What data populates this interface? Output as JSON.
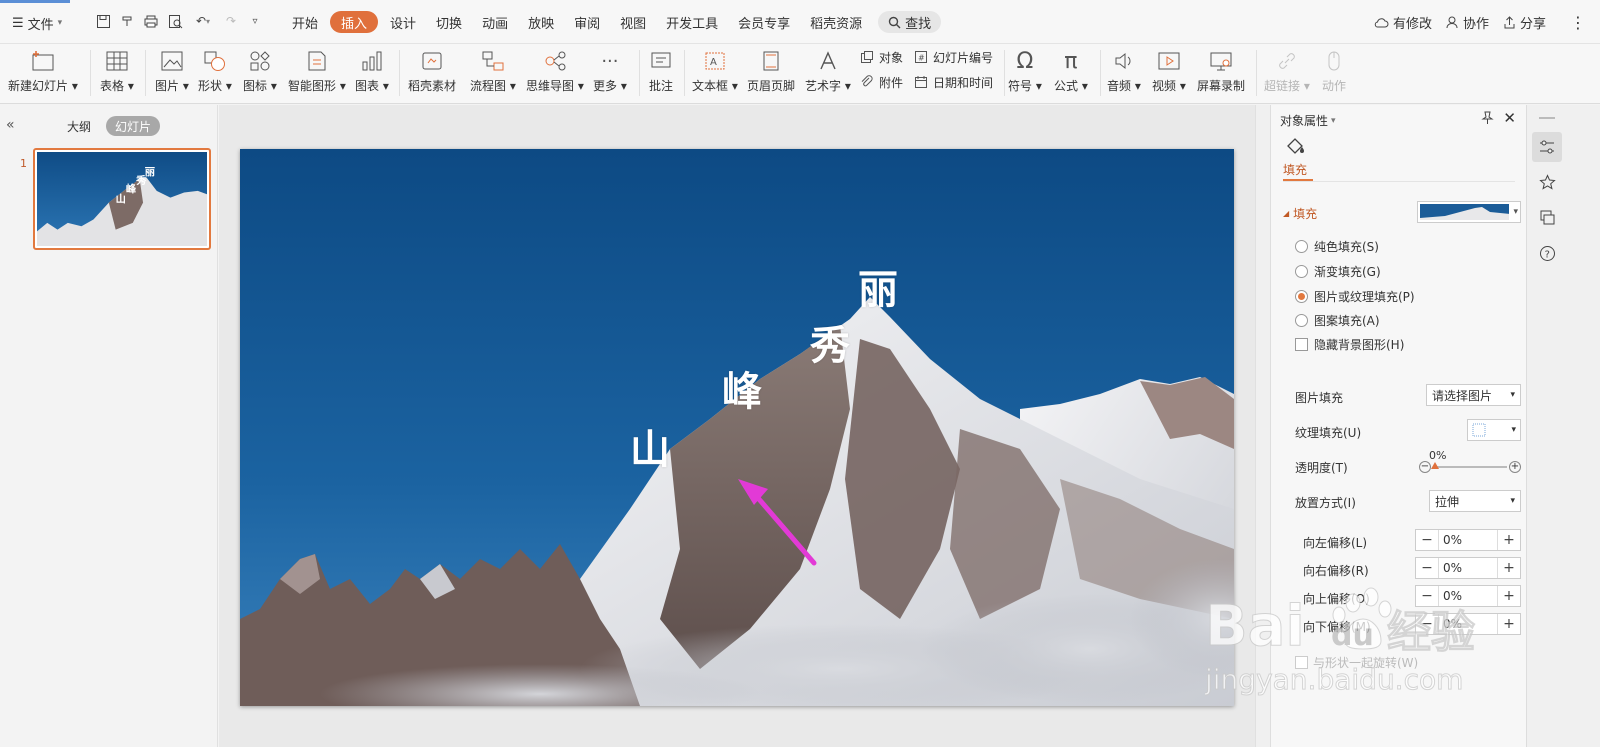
{
  "top": {
    "file_menu": "文件",
    "tabs": [
      "开始",
      "插入",
      "设计",
      "切换",
      "动画",
      "放映",
      "审阅",
      "视图",
      "开发工具",
      "会员专享",
      "稻壳资源"
    ],
    "active_tab": "插入",
    "search": "查找",
    "right": {
      "modified": "有修改",
      "collab": "协作",
      "share": "分享"
    }
  },
  "ribbon": {
    "new_slide": "新建幻灯片",
    "table": "表格",
    "picture": "图片",
    "shape": "形状",
    "icon": "图标",
    "smartart": "智能图形",
    "chart": "图表",
    "daoke": "稻壳素材",
    "flowchart": "流程图",
    "mindmap": "思维导图",
    "more": "更多",
    "comment": "批注",
    "textbox": "文本框",
    "header_footer": "页眉页脚",
    "wordart": "艺术字",
    "object": "对象",
    "slide_number": "幻灯片编号",
    "attachment": "附件",
    "datetime": "日期和时间",
    "symbol": "符号",
    "formula": "公式",
    "audio": "音频",
    "video": "视频",
    "screen_record": "屏幕录制",
    "hyperlink": "超链接",
    "action": "动作"
  },
  "left": {
    "outline_tab": "大纲",
    "slides_tab": "幻灯片",
    "slide_number": "1"
  },
  "slide": {
    "chars": [
      "山",
      "峰",
      "秀",
      "丽"
    ]
  },
  "panel": {
    "title": "对象属性",
    "fill_tab": "填充",
    "section": "填充",
    "options": [
      "纯色填充(S)",
      "渐变填充(G)",
      "图片或纹理填充(P)",
      "图案填充(A)"
    ],
    "selected_option": 2,
    "hide_bg": "隐藏背景图形(H)",
    "picture_fill_label": "图片填充",
    "picture_fill_value": "请选择图片",
    "texture_fill_label": "纹理填充(U)",
    "transparency_label": "透明度(T)",
    "transparency_value": "0%",
    "placement_label": "放置方式(I)",
    "placement_value": "拉伸",
    "offsets": [
      {
        "label": "向左偏移(L)",
        "value": "0%"
      },
      {
        "label": "向右偏移(R)",
        "value": "0%"
      },
      {
        "label": "向上偏移(O)",
        "value": "0%"
      },
      {
        "label": "向下偏移(M)",
        "value": "0%"
      }
    ],
    "rotate_with_shape": "与形状一起旋转(W)"
  },
  "watermark": {
    "brand": "Bai",
    "brand_tail": "du",
    "cn": "经验",
    "url": "jingyan.baidu.com"
  },
  "colors": {
    "accent": "#e0703c",
    "sky": "#17548e",
    "arrow": "#e23ad6"
  }
}
